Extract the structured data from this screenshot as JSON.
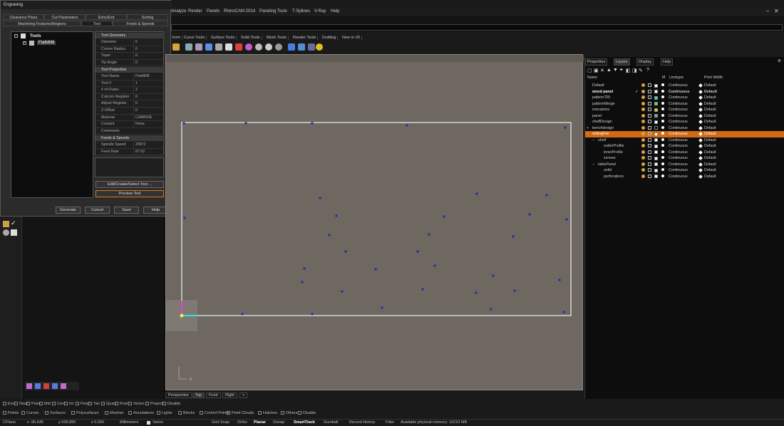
{
  "menubar": {
    "items": [
      "Analyze",
      "Render",
      "Panels",
      "RhinoCAM 2014",
      "Paneling Tools",
      "T-Splines",
      "V-Ray",
      "Help"
    ]
  },
  "toolbar_tabs": [
    "form",
    "Curve Tools",
    "Surface Tools",
    "Solid Tools",
    "Mesh Tools",
    "Render Tools",
    "Drafting",
    "New in V5"
  ],
  "dialog": {
    "title": "Engraving",
    "tabs_row1": [
      "Clearance Plane",
      "Cut Parameters",
      "Entry/Exit",
      "Sorting"
    ],
    "tabs_row2": [
      "Machining Features/Regions",
      "Tool",
      "Feeds & Speeds"
    ],
    "tree_root": "Tools",
    "tree_child": "FlatMill6",
    "sections": {
      "geometry": "Tool Geometry",
      "properties": "Tool Properties",
      "feeds": "Feeds & Speeds"
    },
    "geometry_rows": [
      {
        "k": "Diameter",
        "v": "6"
      },
      {
        "k": "Corner Radius",
        "v": "0"
      },
      {
        "k": "Taper",
        "v": "0"
      },
      {
        "k": "Tip Angle",
        "v": "0"
      }
    ],
    "property_rows": [
      {
        "k": "Tool Name",
        "v": "FlatMill6"
      },
      {
        "k": "Tool #",
        "v": "1"
      },
      {
        "k": "# of Flutes",
        "v": "2"
      },
      {
        "k": "Cutcom Register",
        "v": "0"
      },
      {
        "k": "Adjust Register",
        "v": "0"
      },
      {
        "k": "Z-Offset",
        "v": "0"
      },
      {
        "k": "Material",
        "v": "CARBIDE"
      },
      {
        "k": "Coolant",
        "v": "None"
      },
      {
        "k": "Comments",
        "v": ""
      }
    ],
    "feed_rows": [
      {
        "k": "Spindle Speed",
        "v": "25872"
      },
      {
        "k": "Feed Rate",
        "v": "87.62"
      }
    ],
    "edit_button": "Edit/Create/Select Tool ...",
    "preview_button": "Preview Tool",
    "buttons": [
      "Generate",
      "Cancel",
      "Save",
      "Help"
    ]
  },
  "viewport": {
    "tabs": [
      "Perspective",
      "Top",
      "Front",
      "Right",
      "+"
    ],
    "axis_x": "x",
    "points": [
      [
        257,
        172
      ],
      [
        344,
        172
      ],
      [
        437,
        172
      ],
      [
        570,
        175
      ],
      [
        792,
        178
      ],
      [
        258,
        305
      ],
      [
        448,
        277
      ],
      [
        471,
        302
      ],
      [
        668,
        271
      ],
      [
        766,
        273
      ],
      [
        622,
        303
      ],
      [
        742,
        300
      ],
      [
        794,
        307
      ],
      [
        461,
        329
      ],
      [
        601,
        328
      ],
      [
        719,
        331
      ],
      [
        484,
        352
      ],
      [
        585,
        352
      ],
      [
        426,
        376
      ],
      [
        526,
        377
      ],
      [
        609,
        372
      ],
      [
        423,
        395
      ],
      [
        691,
        386
      ],
      [
        784,
        392
      ],
      [
        479,
        408
      ],
      [
        592,
        405
      ],
      [
        667,
        410
      ],
      [
        721,
        407
      ],
      [
        535,
        431
      ],
      [
        339,
        440
      ],
      [
        437,
        440
      ],
      [
        688,
        433
      ],
      [
        790,
        437
      ]
    ]
  },
  "right_panel": {
    "tabs": [
      "Properties",
      "Layers",
      "Display",
      "Help"
    ],
    "headers": {
      "name": "Name",
      "m": "M",
      "linetype": "Linetype",
      "printwidth": "Print Width"
    },
    "layers": [
      {
        "name": "Default",
        "indent": 0,
        "color": "#ffffff",
        "linetype": "Continuous",
        "pw": "Default",
        "bold": false,
        "sel": false
      },
      {
        "name": "wood panel",
        "indent": 0,
        "color": "#ffffff",
        "linetype": "Continuous",
        "pw": "Default",
        "bold": true,
        "sel": false,
        "check": "✓"
      },
      {
        "name": "patternTRI",
        "indent": 0,
        "color": "#3fd0e0",
        "linetype": "Continuous",
        "pw": "Default",
        "bold": false,
        "sel": false
      },
      {
        "name": "patternMerge",
        "indent": 0,
        "color": "#7fd060",
        "linetype": "Continuous",
        "pw": "Default",
        "bold": false,
        "sel": false
      },
      {
        "name": "extrusions",
        "indent": 0,
        "color": "#e0e030",
        "linetype": "Continuous",
        "pw": "Default",
        "bold": false,
        "sel": false
      },
      {
        "name": "panel",
        "indent": 0,
        "color": "#40c0c0",
        "linetype": "Continuous",
        "pw": "Default",
        "bold": false,
        "sel": false
      },
      {
        "name": "shelfDesign",
        "indent": 0,
        "color": "#ffffff",
        "linetype": "Continuous",
        "pw": "Default",
        "bold": false,
        "sel": false
      },
      {
        "name": "benchdesign",
        "indent": 0,
        "color": "#000000",
        "linetype": "Continuous",
        "pw": "Default",
        "bold": false,
        "sel": false,
        "toggle": "+"
      },
      {
        "name": "millingFile",
        "indent": 0,
        "color": "#ffffff",
        "linetype": "Continuous",
        "pw": "Default",
        "bold": false,
        "sel": true,
        "toggle": "−"
      },
      {
        "name": "shelf",
        "indent": 1,
        "color": "#ffffff",
        "linetype": "Continuous",
        "pw": "Default",
        "bold": false,
        "sel": false,
        "toggle": "−"
      },
      {
        "name": "outterProfile",
        "indent": 2,
        "color": "#ffffff",
        "linetype": "Continuous",
        "pw": "Default",
        "bold": false,
        "sel": false
      },
      {
        "name": "innerProfile",
        "indent": 2,
        "color": "#ffffff",
        "linetype": "Continuous",
        "pw": "Default",
        "bold": false,
        "sel": false
      },
      {
        "name": "screws",
        "indent": 2,
        "color": "#ffffff",
        "linetype": "Continuous",
        "pw": "Default",
        "bold": false,
        "sel": false
      },
      {
        "name": "tablePanel",
        "indent": 1,
        "color": "#ffffff",
        "linetype": "Continuous",
        "pw": "Default",
        "bold": false,
        "sel": false,
        "toggle": "−"
      },
      {
        "name": "solid",
        "indent": 2,
        "color": "#ffffff",
        "linetype": "Continuous",
        "pw": "Default",
        "bold": false,
        "sel": false
      },
      {
        "name": "perforations",
        "indent": 2,
        "color": "#ffffff",
        "linetype": "Continuous",
        "pw": "Default",
        "bold": false,
        "sel": false
      }
    ]
  },
  "osnap": [
    "End",
    "Near",
    "Point",
    "Mid",
    "Cen",
    "Int",
    "Perp",
    "Tan",
    "Quad",
    "Knot",
    "Vertex",
    "Project",
    "Disable"
  ],
  "filters": [
    "Points",
    "Curves",
    "Surfaces",
    "Polysurfaces",
    "Meshes",
    "Annotations",
    "Lights",
    "Blocks",
    "Control Points",
    "Point Clouds",
    "Hatches",
    "Others",
    "Disable"
  ],
  "status": {
    "cplane": "CPlane",
    "x": "x -95.645",
    "y": "y 628.890",
    "z": "z 0.000",
    "units": "Millimeters",
    "layer": "Varies",
    "toggles": [
      "Grid Snap",
      "Ortho",
      "Planar",
      "Osnap",
      "SmartTrack",
      "Gumball",
      "Record History",
      "Filter"
    ],
    "memory": "Available physical memory: 10210 MB"
  }
}
